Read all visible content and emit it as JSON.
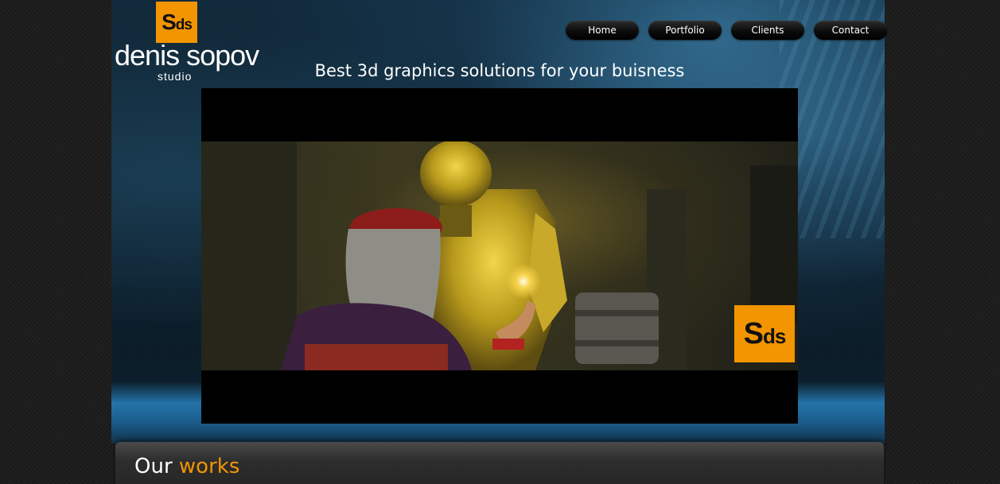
{
  "logo": {
    "mark_big": "S",
    "mark_small": "ds",
    "name": "denis sopov",
    "subtitle": "studio"
  },
  "nav": {
    "items": [
      {
        "label": "Home"
      },
      {
        "label": "Portfolio"
      },
      {
        "label": "Clients"
      },
      {
        "label": "Contact"
      }
    ]
  },
  "hero": {
    "tagline": "Best 3d graphics solutions for your buisness"
  },
  "video": {
    "badge_big": "S",
    "badge_small": "ds"
  },
  "works": {
    "title_part1": "Our",
    "title_part2": "works"
  },
  "colors": {
    "accent": "#f29500",
    "background": "#1e1e1e",
    "hero_blue": "#1b5d8c",
    "nav_button": "#0c0c0c"
  }
}
